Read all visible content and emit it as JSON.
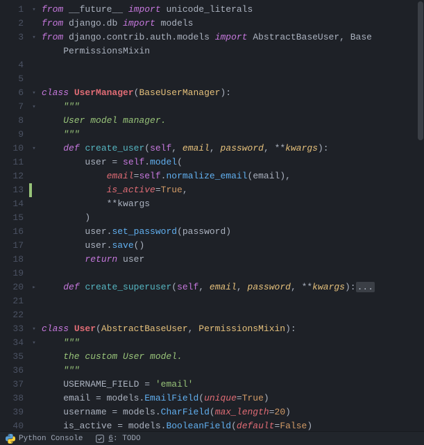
{
  "editor": {
    "line_numbers": [
      "1",
      "2",
      "3",
      "",
      "4",
      "5",
      "6",
      "7",
      "8",
      "9",
      "10",
      "11",
      "12",
      "13",
      "14",
      "15",
      "16",
      "17",
      "18",
      "19",
      "20",
      "21",
      "22",
      "33",
      "34",
      "35",
      "36",
      "37",
      "38",
      "39",
      "40"
    ],
    "fold_markers": [
      "▾",
      "",
      "▾",
      "",
      "",
      "",
      "▾",
      "▾",
      "",
      "",
      "▾",
      "",
      "",
      "",
      "",
      "",
      "",
      "",
      "",
      "",
      "▸",
      "",
      "",
      "▾",
      "▾",
      "",
      "",
      "",
      "",
      "",
      ""
    ],
    "changed_line_index": 13,
    "lines": [
      {
        "tokens": [
          {
            "c": "kw",
            "t": "from"
          },
          {
            "c": "op",
            "t": " __future__ "
          },
          {
            "c": "kw",
            "t": "import"
          },
          {
            "c": "ident",
            "t": " unicode_literals"
          }
        ]
      },
      {
        "tokens": [
          {
            "c": "kw",
            "t": "from"
          },
          {
            "c": "ident",
            "t": " django"
          },
          {
            "c": "punct",
            "t": "."
          },
          {
            "c": "ident",
            "t": "db "
          },
          {
            "c": "kw",
            "t": "import"
          },
          {
            "c": "ident",
            "t": " models"
          }
        ]
      },
      {
        "tokens": [
          {
            "c": "kw",
            "t": "from"
          },
          {
            "c": "ident",
            "t": " django"
          },
          {
            "c": "punct",
            "t": "."
          },
          {
            "c": "ident",
            "t": "contrib"
          },
          {
            "c": "punct",
            "t": "."
          },
          {
            "c": "ident",
            "t": "auth"
          },
          {
            "c": "punct",
            "t": "."
          },
          {
            "c": "ident",
            "t": "models "
          },
          {
            "c": "kw",
            "t": "import"
          },
          {
            "c": "ident",
            "t": " AbstractBaseUser"
          },
          {
            "c": "punct",
            "t": ", "
          },
          {
            "c": "ident",
            "t": "Base"
          }
        ]
      },
      {
        "tokens": [
          {
            "c": "ident",
            "t": "    PermissionsMixin"
          }
        ]
      },
      {
        "tokens": []
      },
      {
        "tokens": []
      },
      {
        "tokens": [
          {
            "c": "kw",
            "t": "class "
          },
          {
            "c": "cls",
            "t": "UserManager"
          },
          {
            "c": "punct",
            "t": "("
          },
          {
            "c": "clsref",
            "t": "BaseUserManager"
          },
          {
            "c": "punct",
            "t": "):"
          }
        ]
      },
      {
        "tokens": [
          {
            "c": "doc",
            "t": "    \"\"\""
          }
        ]
      },
      {
        "tokens": [
          {
            "c": "doc",
            "t": "    User model manager."
          }
        ]
      },
      {
        "tokens": [
          {
            "c": "doc",
            "t": "    \"\"\""
          }
        ]
      },
      {
        "tokens": [
          {
            "c": "ident",
            "t": "    "
          },
          {
            "c": "kw",
            "t": "def "
          },
          {
            "c": "fn",
            "t": "create_user"
          },
          {
            "c": "punct",
            "t": "("
          },
          {
            "c": "self",
            "t": "self"
          },
          {
            "c": "punct",
            "t": ", "
          },
          {
            "c": "param",
            "t": "email"
          },
          {
            "c": "punct",
            "t": ", "
          },
          {
            "c": "param",
            "t": "password"
          },
          {
            "c": "punct",
            "t": ", "
          },
          {
            "c": "op",
            "t": "**"
          },
          {
            "c": "param",
            "t": "kwargs"
          },
          {
            "c": "punct",
            "t": "):"
          }
        ]
      },
      {
        "tokens": [
          {
            "c": "ident",
            "t": "        user "
          },
          {
            "c": "op",
            "t": "="
          },
          {
            "c": "ident",
            "t": " "
          },
          {
            "c": "self",
            "t": "self"
          },
          {
            "c": "punct",
            "t": "."
          },
          {
            "c": "fncall",
            "t": "model"
          },
          {
            "c": "punct",
            "t": "("
          }
        ]
      },
      {
        "tokens": [
          {
            "c": "ident",
            "t": "            "
          },
          {
            "c": "kwarg",
            "t": "email"
          },
          {
            "c": "op",
            "t": "="
          },
          {
            "c": "self",
            "t": "self"
          },
          {
            "c": "punct",
            "t": "."
          },
          {
            "c": "fncall",
            "t": "normalize_email"
          },
          {
            "c": "punct",
            "t": "("
          },
          {
            "c": "ident",
            "t": "email"
          },
          {
            "c": "punct",
            "t": "),"
          }
        ]
      },
      {
        "tokens": [
          {
            "c": "ident",
            "t": "            "
          },
          {
            "c": "kwarg",
            "t": "is_active"
          },
          {
            "c": "op",
            "t": "="
          },
          {
            "c": "bool",
            "t": "True"
          },
          {
            "c": "punct",
            "t": ","
          }
        ]
      },
      {
        "tokens": [
          {
            "c": "ident",
            "t": "            "
          },
          {
            "c": "op",
            "t": "**"
          },
          {
            "c": "ident",
            "t": "kwargs"
          }
        ]
      },
      {
        "tokens": [
          {
            "c": "ident",
            "t": "        "
          },
          {
            "c": "punct",
            "t": ")"
          }
        ]
      },
      {
        "tokens": [
          {
            "c": "ident",
            "t": "        user"
          },
          {
            "c": "punct",
            "t": "."
          },
          {
            "c": "fncall",
            "t": "set_password"
          },
          {
            "c": "punct",
            "t": "("
          },
          {
            "c": "ident",
            "t": "password"
          },
          {
            "c": "punct",
            "t": ")"
          }
        ]
      },
      {
        "tokens": [
          {
            "c": "ident",
            "t": "        user"
          },
          {
            "c": "punct",
            "t": "."
          },
          {
            "c": "fncall",
            "t": "save"
          },
          {
            "c": "punct",
            "t": "()"
          }
        ]
      },
      {
        "tokens": [
          {
            "c": "ident",
            "t": "        "
          },
          {
            "c": "kw",
            "t": "return"
          },
          {
            "c": "ident",
            "t": " user"
          }
        ]
      },
      {
        "tokens": []
      },
      {
        "tokens": [
          {
            "c": "ident",
            "t": "    "
          },
          {
            "c": "kw",
            "t": "def "
          },
          {
            "c": "fn",
            "t": "create_superuser"
          },
          {
            "c": "punct",
            "t": "("
          },
          {
            "c": "self",
            "t": "self"
          },
          {
            "c": "punct",
            "t": ", "
          },
          {
            "c": "param",
            "t": "email"
          },
          {
            "c": "punct",
            "t": ", "
          },
          {
            "c": "param",
            "t": "password"
          },
          {
            "c": "punct",
            "t": ", "
          },
          {
            "c": "op",
            "t": "**"
          },
          {
            "c": "param",
            "t": "kwargs"
          },
          {
            "c": "punct",
            "t": "):"
          },
          {
            "c": "fold-dots",
            "t": "..."
          }
        ]
      },
      {
        "tokens": []
      },
      {
        "tokens": []
      },
      {
        "tokens": [
          {
            "c": "kw",
            "t": "class "
          },
          {
            "c": "cls",
            "t": "User"
          },
          {
            "c": "punct",
            "t": "("
          },
          {
            "c": "clsref",
            "t": "AbstractBaseUser"
          },
          {
            "c": "punct",
            "t": ", "
          },
          {
            "c": "clsref",
            "t": "PermissionsMixin"
          },
          {
            "c": "punct",
            "t": "):"
          }
        ]
      },
      {
        "tokens": [
          {
            "c": "doc",
            "t": "    \"\"\""
          }
        ]
      },
      {
        "tokens": [
          {
            "c": "doc",
            "t": "    the custom User model."
          }
        ]
      },
      {
        "tokens": [
          {
            "c": "doc",
            "t": "    \"\"\""
          }
        ]
      },
      {
        "tokens": [
          {
            "c": "ident",
            "t": "    USERNAME_FIELD "
          },
          {
            "c": "op",
            "t": "="
          },
          {
            "c": "ident",
            "t": " "
          },
          {
            "c": "str",
            "t": "'email'"
          }
        ]
      },
      {
        "tokens": [
          {
            "c": "ident",
            "t": "    email "
          },
          {
            "c": "op",
            "t": "="
          },
          {
            "c": "ident",
            "t": " models"
          },
          {
            "c": "punct",
            "t": "."
          },
          {
            "c": "fncall",
            "t": "EmailField"
          },
          {
            "c": "punct",
            "t": "("
          },
          {
            "c": "kwarg",
            "t": "unique"
          },
          {
            "c": "op",
            "t": "="
          },
          {
            "c": "bool",
            "t": "True"
          },
          {
            "c": "punct",
            "t": ")"
          }
        ]
      },
      {
        "tokens": [
          {
            "c": "ident",
            "t": "    username "
          },
          {
            "c": "op",
            "t": "="
          },
          {
            "c": "ident",
            "t": " models"
          },
          {
            "c": "punct",
            "t": "."
          },
          {
            "c": "fncall",
            "t": "CharField"
          },
          {
            "c": "punct",
            "t": "("
          },
          {
            "c": "kwarg",
            "t": "max_length"
          },
          {
            "c": "op",
            "t": "="
          },
          {
            "c": "num",
            "t": "20"
          },
          {
            "c": "punct",
            "t": ")"
          }
        ]
      },
      {
        "tokens": [
          {
            "c": "ident",
            "t": "    is_active "
          },
          {
            "c": "op",
            "t": "="
          },
          {
            "c": "ident",
            "t": " models"
          },
          {
            "c": "punct",
            "t": "."
          },
          {
            "c": "fncall",
            "t": "BooleanField"
          },
          {
            "c": "punct",
            "t": "("
          },
          {
            "c": "kwarg",
            "t": "default"
          },
          {
            "c": "op",
            "t": "="
          },
          {
            "c": "bool",
            "t": "False"
          },
          {
            "c": "punct",
            "t": ")"
          }
        ]
      }
    ]
  },
  "statusbar": {
    "python_console": "Python Console",
    "todo": "6: TODO",
    "todo_underline": "6"
  }
}
